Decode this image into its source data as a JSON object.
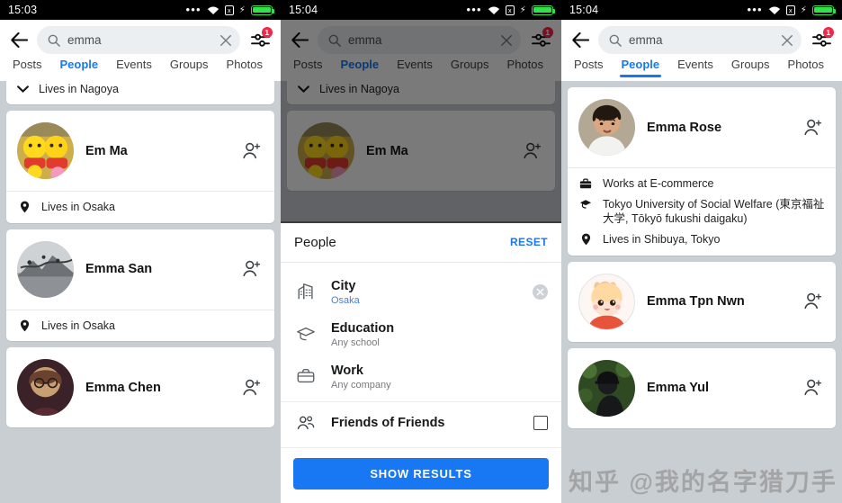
{
  "app": {
    "name": "Facebook Search",
    "accent": "#1877f2",
    "badge_color": "#f02849",
    "list_bg": "#c9ced3"
  },
  "panels": [
    {
      "id": "results-osaka",
      "status": {
        "time": "15:03",
        "dots": "…",
        "wifi": "wifi-icon",
        "box": "x",
        "bolt": "⚡",
        "battery": "battery-full-icon"
      },
      "search": {
        "value": "emma",
        "placeholder": "Search",
        "clear_label": "×",
        "filter_badge": "1"
      },
      "tabs": [
        {
          "label": "Posts",
          "active": false
        },
        {
          "label": "People",
          "active": true
        },
        {
          "label": "Events",
          "active": false
        },
        {
          "label": "Groups",
          "active": false
        },
        {
          "label": "Photos",
          "active": false
        }
      ],
      "tab_underline": false,
      "partial_top": {
        "text": "Lives in Nagoya",
        "icon": "chevron-down-icon"
      },
      "cards": [
        {
          "name": "Em Ma",
          "avatar": "pooh-plush",
          "action": "add-friend-icon",
          "meta": [
            {
              "icon": "location-pin-icon",
              "text": "Lives in Osaka"
            }
          ]
        },
        {
          "name": "Emma San",
          "avatar": "cherry-blossom-bw",
          "action": "add-friend-icon",
          "meta": [
            {
              "icon": "location-pin-icon",
              "text": "Lives in Osaka"
            }
          ]
        },
        {
          "name": "Emma Chen",
          "avatar": "portrait-glasses",
          "action": "add-friend-icon",
          "meta": []
        }
      ]
    },
    {
      "id": "filter-sheet",
      "status": {
        "time": "15:04",
        "dots": "…"
      },
      "search": {
        "value": "emma",
        "filter_badge": "1"
      },
      "tabs": [
        {
          "label": "Posts",
          "active": false
        },
        {
          "label": "People",
          "active": true
        },
        {
          "label": "Events",
          "active": false
        },
        {
          "label": "Groups",
          "active": false
        },
        {
          "label": "Photos",
          "active": false
        }
      ],
      "tab_underline": false,
      "partial_top": {
        "text": "Lives in Nagoya",
        "icon": "chevron-down-icon"
      },
      "cards": [
        {
          "name": "Em Ma",
          "avatar": "pooh-plush",
          "action": "add-friend-icon",
          "meta": []
        }
      ],
      "sheet": {
        "title": "People",
        "reset_label": "RESET",
        "filters": [
          {
            "icon": "city-buildings-icon",
            "label": "City",
            "value": "Osaka",
            "value_blue": true,
            "clearable": true
          },
          {
            "icon": "graduation-cap-icon",
            "label": "Education",
            "value": "Any school",
            "value_blue": false,
            "clearable": false
          },
          {
            "icon": "briefcase-icon",
            "label": "Work",
            "value": "Any company",
            "value_blue": false,
            "clearable": false
          }
        ],
        "toggle": {
          "icon": "people-group-icon",
          "label": "Friends of Friends",
          "checked": false
        },
        "submit_label": "SHOW RESULTS"
      }
    },
    {
      "id": "results-tokyo",
      "status": {
        "time": "15:04",
        "dots": "…"
      },
      "search": {
        "value": "emma",
        "filter_badge": "1"
      },
      "tabs": [
        {
          "label": "Posts",
          "active": false
        },
        {
          "label": "People",
          "active": true
        },
        {
          "label": "Events",
          "active": false
        },
        {
          "label": "Groups",
          "active": false
        },
        {
          "label": "Photos",
          "active": false
        }
      ],
      "tab_underline": true,
      "cards": [
        {
          "name": "Emma Rose",
          "avatar": "woman-short-hair",
          "action": "add-friend-icon",
          "meta": [
            {
              "icon": "briefcase-icon",
              "text": "Works at E-commerce"
            },
            {
              "icon": "graduation-cap-icon",
              "text": "Tokyo University of Social Welfare (東京福祉大学, Tōkyō fukushi daigaku)"
            },
            {
              "icon": "location-pin-icon",
              "text": "Lives in Shibuya, Tokyo"
            }
          ]
        },
        {
          "name": "Emma Tpn Nwn",
          "avatar": "anime-girl-bunny",
          "action": "add-friend-icon",
          "meta": []
        },
        {
          "name": "Emma Yul",
          "avatar": "person-black-cap",
          "action": "add-friend-icon",
          "meta": []
        }
      ],
      "watermark": "知乎 @我的名字猎刀手"
    }
  ]
}
